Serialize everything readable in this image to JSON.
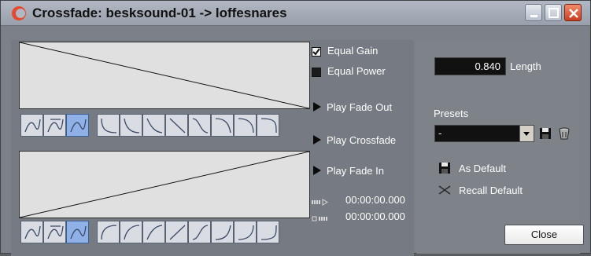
{
  "window": {
    "title": "Crossfade: besksound-01 -> loffesnares",
    "app_icon": "cubase-logo-icon",
    "controls": {
      "minimize": "minimize-icon",
      "maximize": "maximize-icon",
      "close": "close-x-icon"
    }
  },
  "options": {
    "equal_gain": {
      "label": "Equal Gain",
      "checked": true
    },
    "equal_power": {
      "label": "Equal Power",
      "checked": false
    }
  },
  "play": {
    "fade_out": "Play Fade Out",
    "crossfade": "Play Crossfade",
    "fade_in": "Play Fade In"
  },
  "times": {
    "fade_out_time": "00:00:00.000",
    "fade_in_time": "00:00:00.000"
  },
  "length": {
    "value": "0.840",
    "label": "Length"
  },
  "presets": {
    "label": "Presets",
    "selected": "-",
    "save_icon": "floppy-disk-icon",
    "delete_icon": "trash-icon"
  },
  "defaults": {
    "as_default": "As Default",
    "recall_default": "Recall Default"
  },
  "buttons": {
    "close": "Close"
  },
  "curve_buttons": {
    "fade_out": [
      "spline-icon",
      "damped-spline-icon",
      "linear-spline-icon",
      "fade-out-preset-1-icon",
      "fade-out-preset-2-icon",
      "fade-out-preset-3-icon",
      "fade-out-preset-4-icon",
      "fade-out-preset-5-icon",
      "fade-out-preset-6-icon",
      "fade-out-preset-7-icon",
      "fade-out-preset-8-icon"
    ],
    "fade_in": [
      "spline-icon",
      "damped-spline-icon",
      "linear-spline-icon",
      "fade-in-preset-1-icon",
      "fade-in-preset-2-icon",
      "fade-in-preset-3-icon",
      "fade-in-preset-4-icon",
      "fade-in-preset-5-icon",
      "fade-in-preset-6-icon",
      "fade-in-preset-7-icon",
      "fade-in-preset-8-icon"
    ],
    "selected_index": 2
  },
  "colors": {
    "panel": "#7c8088",
    "graph_bg": "#e0e0e0",
    "selected_button": "#8fb1e8"
  }
}
